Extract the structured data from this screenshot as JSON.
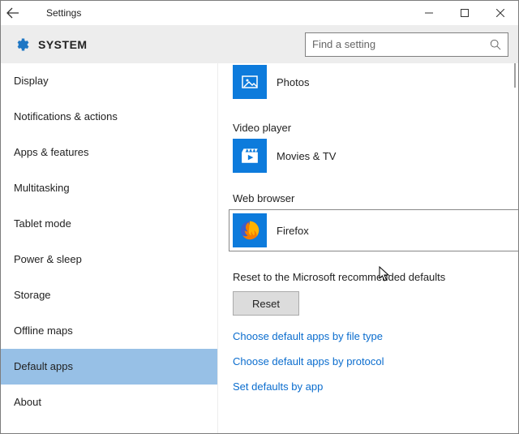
{
  "window": {
    "title": "Settings",
    "breadcrumb": "SYSTEM"
  },
  "search": {
    "placeholder": "Find a setting"
  },
  "sidebar": {
    "items": [
      {
        "label": "Display"
      },
      {
        "label": "Notifications & actions"
      },
      {
        "label": "Apps & features"
      },
      {
        "label": "Multitasking"
      },
      {
        "label": "Tablet mode"
      },
      {
        "label": "Power & sleep"
      },
      {
        "label": "Storage"
      },
      {
        "label": "Offline maps"
      },
      {
        "label": "Default apps"
      },
      {
        "label": "About"
      }
    ],
    "active": 8
  },
  "main": {
    "photos": {
      "label": "Photos"
    },
    "videoplayer": {
      "heading": "Video player",
      "app": "Movies & TV"
    },
    "webbrowser": {
      "heading": "Web browser",
      "app": "Firefox"
    },
    "reset": {
      "heading": "Reset to the Microsoft recommended defaults",
      "button": "Reset"
    },
    "links": {
      "byfiletype": "Choose default apps by file type",
      "byprotocol": "Choose default apps by protocol",
      "byapp": "Set defaults by app"
    }
  }
}
